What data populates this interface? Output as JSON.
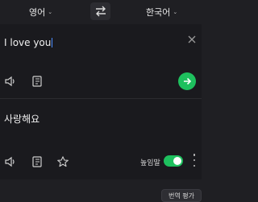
{
  "languages": {
    "source": "영어",
    "target": "한국어"
  },
  "input": {
    "text": "I love you"
  },
  "output": {
    "text": "사랑해요"
  },
  "options": {
    "honorific_label": "높임말",
    "honorific_on": true
  },
  "footer": {
    "rate_button": "번역 평가"
  },
  "colors": {
    "accent": "#1ec05e",
    "background": "#1f1f23",
    "panel": "#1a1a1e"
  },
  "icons": [
    "chevron-down-icon",
    "swap-icon",
    "close-icon",
    "speaker-icon",
    "book-icon",
    "arrow-right-icon",
    "star-icon",
    "more-icon"
  ]
}
